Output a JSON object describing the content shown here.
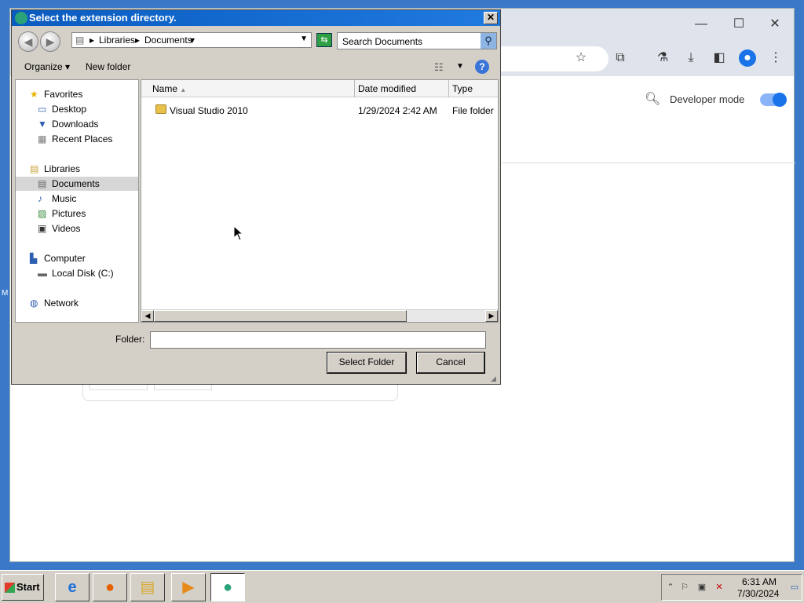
{
  "desktop": {
    "edge_label": "M"
  },
  "chrome": {
    "controls": {
      "minimize": "—",
      "maximize": "☐",
      "close": "✕"
    },
    "toolbar_icons": [
      "star-icon",
      "extensions-icon",
      "labs-icon",
      "download-icon",
      "side-panel-icon",
      "profile-icon",
      "menu-icon"
    ],
    "developer_mode_label": "Developer mode",
    "developer_mode_on": true
  },
  "dialog": {
    "title": "Select the extension directory.",
    "close_label": "✕",
    "breadcrumb": [
      "Libraries",
      "Documents"
    ],
    "search_placeholder": "Search Documents",
    "commands": {
      "organize": "Organize",
      "new_folder": "New folder"
    },
    "help_label": "?",
    "nav_pane": {
      "favorites": {
        "label": "Favorites",
        "items": [
          "Desktop",
          "Downloads",
          "Recent Places"
        ]
      },
      "libraries": {
        "label": "Libraries",
        "items": [
          "Documents",
          "Music",
          "Pictures",
          "Videos"
        ]
      },
      "computer": {
        "label": "Computer",
        "items": [
          "Local Disk (C:)"
        ]
      },
      "network": {
        "label": "Network"
      }
    },
    "columns": [
      "Name",
      "Date modified",
      "Type"
    ],
    "files": [
      {
        "name": "Visual Studio 2010",
        "date": "1/29/2024 2:42 AM",
        "type": "File folder"
      }
    ],
    "folder_label": "Folder:",
    "folder_value": "",
    "buttons": {
      "select": "Select Folder",
      "cancel": "Cancel"
    }
  },
  "taskbar": {
    "start_label": "Start",
    "apps": [
      "internet-explorer-icon",
      "firefox-icon",
      "file-explorer-icon",
      "media-player-icon",
      "chrome-dialog-icon"
    ],
    "clock": {
      "time": "6:31 AM",
      "date": "7/30/2024"
    }
  }
}
